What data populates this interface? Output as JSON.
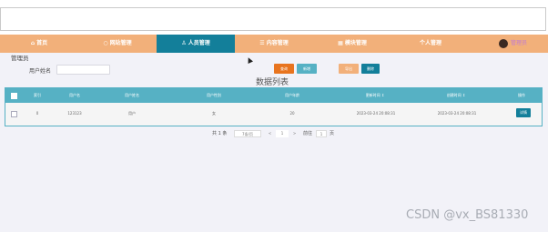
{
  "nav": {
    "items": [
      {
        "icon": "home-icon",
        "glyph": "⌂",
        "label": "首页"
      },
      {
        "icon": "circle-icon",
        "glyph": "○",
        "label": "网站管理"
      },
      {
        "icon": "user-icon",
        "glyph": "♙",
        "label": "人员管理"
      },
      {
        "icon": "content-icon",
        "glyph": "☰",
        "label": "内容管理"
      },
      {
        "icon": "block-icon",
        "glyph": "▦",
        "label": "模块管理"
      },
      {
        "icon": "person-icon",
        "glyph": "",
        "label": "个人管理"
      }
    ],
    "admin_label": "管理员"
  },
  "breadcrumb": "管理员",
  "search": {
    "label": "用户姓名",
    "placeholder": ""
  },
  "buttons": {
    "query": "查询",
    "add": "新增",
    "export": "导出",
    "delete": "删除"
  },
  "table": {
    "title": "数据列表",
    "headers": [
      "索引",
      "用户名",
      "用户姓名",
      "用户性别",
      "用户年龄",
      "更新时间 ↕",
      "创建时间 ↕",
      "操作"
    ],
    "rows": [
      [
        "0",
        "123123",
        "用户",
        "女",
        "20",
        "2023-03-24 20:08:31",
        "2023-03-24 20:08:31",
        "详情"
      ]
    ]
  },
  "pagination": {
    "total": "共 1 条",
    "page_size": "7条/页",
    "prev": "<",
    "page": "1",
    "next": ">",
    "goto": "前往",
    "goto_value": "1",
    "page_unit": "页"
  },
  "watermark": "CSDN @vx_BS81330",
  "colors": {
    "nav": "#f2b07a",
    "nav_active": "#137f9a",
    "table_header": "#56b1c4"
  }
}
